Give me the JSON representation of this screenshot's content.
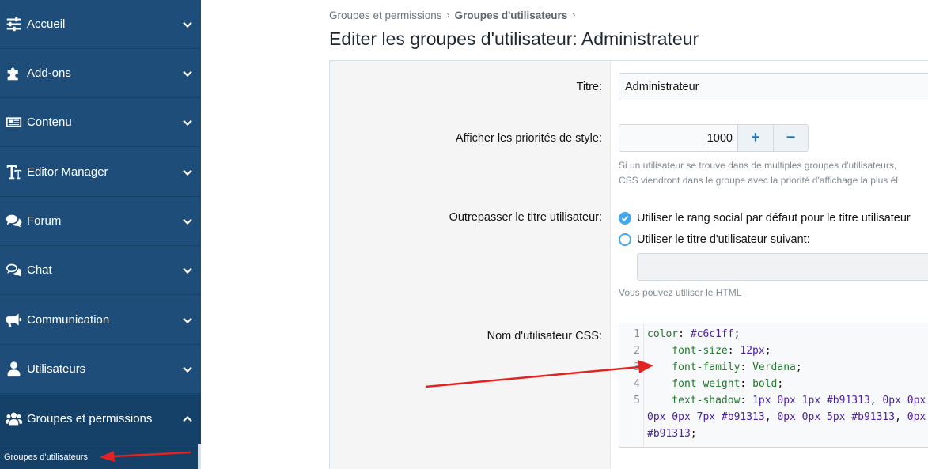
{
  "sidebar": {
    "items": [
      {
        "label": "Accueil",
        "icon": "sliders-icon"
      },
      {
        "label": "Add-ons",
        "icon": "puzzle-icon"
      },
      {
        "label": "Contenu",
        "icon": "newspaper-icon"
      },
      {
        "label": "Editor Manager",
        "icon": "text-format-icon"
      },
      {
        "label": "Forum",
        "icon": "comments-icon"
      },
      {
        "label": "Chat",
        "icon": "chat-bubbles-icon"
      },
      {
        "label": "Communication",
        "icon": "megaphone-icon"
      },
      {
        "label": "Utilisateurs",
        "icon": "user-icon"
      },
      {
        "label": "Groupes et permissions",
        "icon": "users-icon"
      }
    ],
    "sub_item": "Groupes d'utilisateurs"
  },
  "breadcrumb": {
    "items": [
      "Groupes et permissions",
      "Groupes d'utilisateurs"
    ],
    "separator": "›"
  },
  "page_title": "Editer les groupes d'utilisateur: Administrateur",
  "form": {
    "title": {
      "label": "Titre:",
      "value": "Administrateur"
    },
    "priority": {
      "label": "Afficher les priorités de style:",
      "value": "1000",
      "plus": "+",
      "minus": "−",
      "hint_line1": "Si un utilisateur se trouve dans de multiples groupes d'utilisateurs,",
      "hint_line2": "CSS viendront dans le groupe avec la priorité d'affichage la plus él"
    },
    "user_title": {
      "label": "Outrepasser le titre utilisateur:",
      "option_default": "Utiliser le rang social par défaut pour le titre utilisateur",
      "option_custom": "Utiliser le titre d'utilisateur suivant:",
      "hint": "Vous pouvez utiliser le HTML"
    },
    "username_css": {
      "label": "Nom d'utilisateur CSS:",
      "line_numbers": [
        "1",
        "2",
        "3",
        "4",
        "5"
      ],
      "lines": [
        [
          {
            "t": "color",
            "k": "prop"
          },
          {
            "t": ": ",
            "k": "punc"
          },
          {
            "t": "#c6c1ff",
            "k": "val"
          },
          {
            "t": ";",
            "k": "punc"
          }
        ],
        [
          {
            "t": "    font-size",
            "k": "prop"
          },
          {
            "t": ": ",
            "k": "punc"
          },
          {
            "t": "12px",
            "k": "val"
          },
          {
            "t": ";",
            "k": "punc"
          }
        ],
        [
          {
            "t": "    font-family",
            "k": "prop"
          },
          {
            "t": ": ",
            "k": "punc"
          },
          {
            "t": "Verdana",
            "k": "prop"
          },
          {
            "t": ";",
            "k": "punc"
          }
        ],
        [
          {
            "t": "    font-weight",
            "k": "prop"
          },
          {
            "t": ": ",
            "k": "punc"
          },
          {
            "t": "bold",
            "k": "prop"
          },
          {
            "t": ";",
            "k": "punc"
          }
        ],
        [
          {
            "t": "    text-shadow",
            "k": "prop"
          },
          {
            "t": ": ",
            "k": "punc"
          },
          {
            "t": "1px 0px 1px ",
            "k": "val"
          },
          {
            "t": "#b91313",
            "k": "val"
          },
          {
            "t": ", ",
            "k": "punc"
          },
          {
            "t": "0px 0px",
            "k": "val"
          }
        ],
        [
          {
            "t": "0px 0px 7px ",
            "k": "val"
          },
          {
            "t": "#b91313",
            "k": "val"
          },
          {
            "t": ", ",
            "k": "punc"
          },
          {
            "t": "0px 0px 5px ",
            "k": "val"
          },
          {
            "t": "#b91313",
            "k": "val"
          },
          {
            "t": ", ",
            "k": "punc"
          },
          {
            "t": "0px",
            "k": "val"
          }
        ],
        [
          {
            "t": "#b91313",
            "k": "val"
          },
          {
            "t": ";",
            "k": "punc"
          }
        ]
      ]
    }
  },
  "colors": {
    "sidebar_bg": "#1d4d78",
    "accent": "#2577b1",
    "radio": "#47a7eb",
    "annotation_arrow": "#e32222"
  }
}
